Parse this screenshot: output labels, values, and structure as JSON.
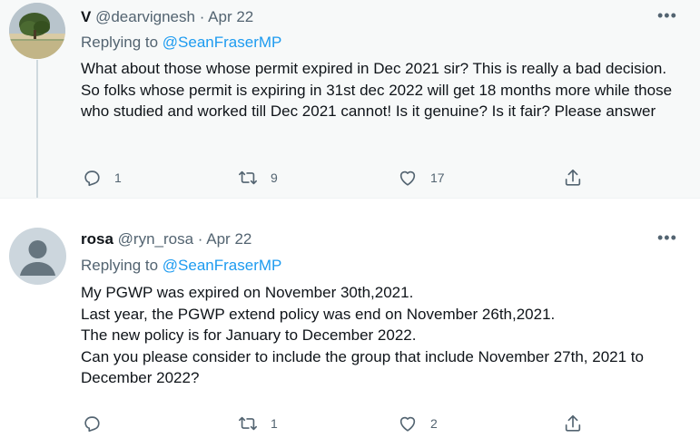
{
  "tweets": [
    {
      "display_name": "V",
      "handle": "@dearvignesh",
      "date": "Apr 22",
      "replying_label": "Replying to",
      "replying_to": "@SeanFraserMP",
      "text": "What about those whose permit expired in Dec 2021 sir? This is really a bad decision. So folks whose permit is expiring in 31st dec 2022 will get 18 months more while those who studied and worked till Dec 2021 cannot! Is it genuine? Is it fair? Please answer",
      "reply_count": "1",
      "retweet_count": "9",
      "like_count": "17",
      "avatar_icon": "tree-photo-avatar"
    },
    {
      "display_name": "rosa",
      "handle": "@ryn_rosa",
      "date": "Apr 22",
      "replying_label": "Replying to",
      "replying_to": "@SeanFraserMP",
      "text": "My PGWP was expired on November 30th,2021.\nLast year, the PGWP extend policy was end on November 26th,2021.\nThe new policy is for January to December 2022.\nCan you please consider to include the group that include November 27th, 2021 to December 2022?",
      "reply_count": "",
      "retweet_count": "1",
      "like_count": "2",
      "avatar_icon": "default-person-avatar"
    }
  ],
  "more_icon": "more-dots-icon",
  "colors": {
    "link": "#1d9bf0",
    "secondary_text": "#536471",
    "highlight_bg": "#f7f9f9"
  }
}
